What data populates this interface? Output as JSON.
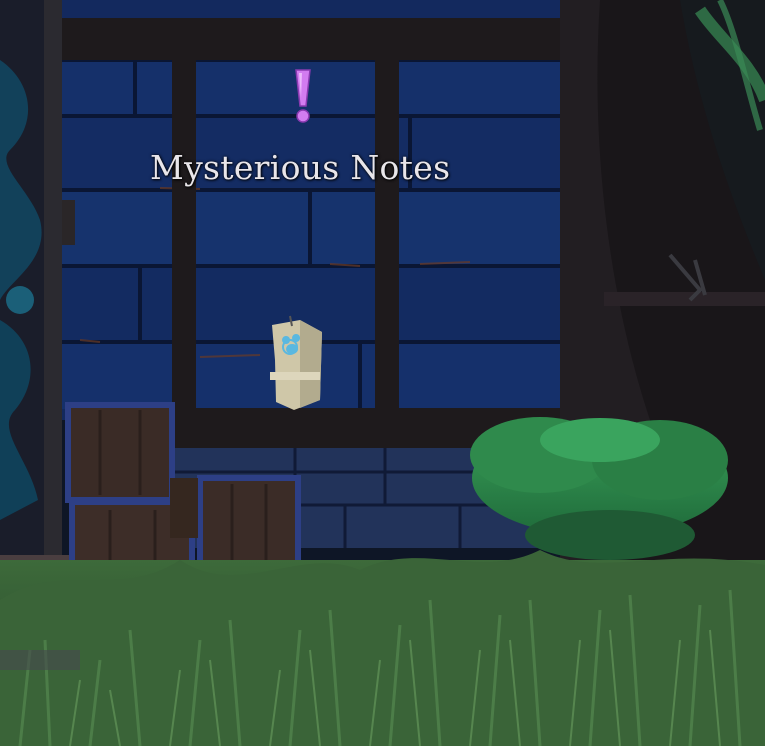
{
  "scene": {
    "quest_marker": {
      "label": "Mysterious Notes",
      "icon": "exclamation-marker-icon",
      "color": "#d27cf0"
    },
    "colors": {
      "wall_planks": "#13295e",
      "wood_frame": "#1e1a1c",
      "grass": "#3f6b3a",
      "bush": "#2e8a4a",
      "crate_metal": "#2d3f86"
    }
  }
}
